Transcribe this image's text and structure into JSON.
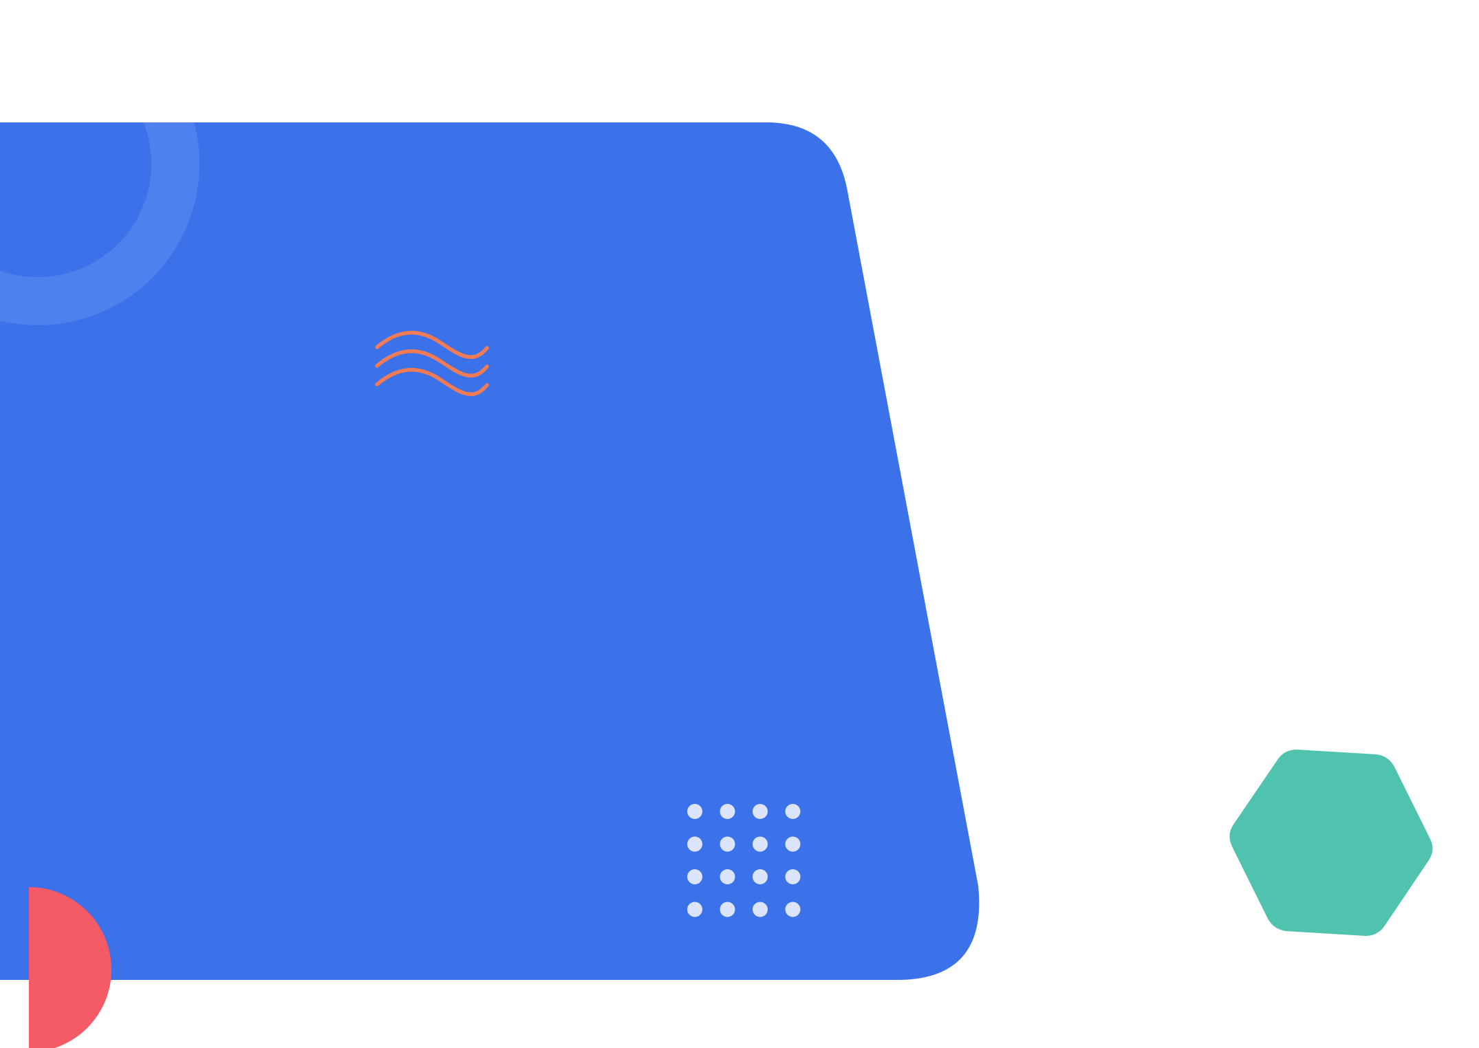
{
  "colors": {
    "background": "#ffffff",
    "panel": "#3B71E9",
    "ring": "#4E80EE",
    "wave": "#F07B55",
    "dots": "#DCE4FA",
    "half_circle": "#F55A67",
    "hexagon": "#50C3AE"
  },
  "decorations": {
    "wave_icon": "wave-lines-icon",
    "dot_grid": {
      "rows": 4,
      "columns": 4
    }
  }
}
